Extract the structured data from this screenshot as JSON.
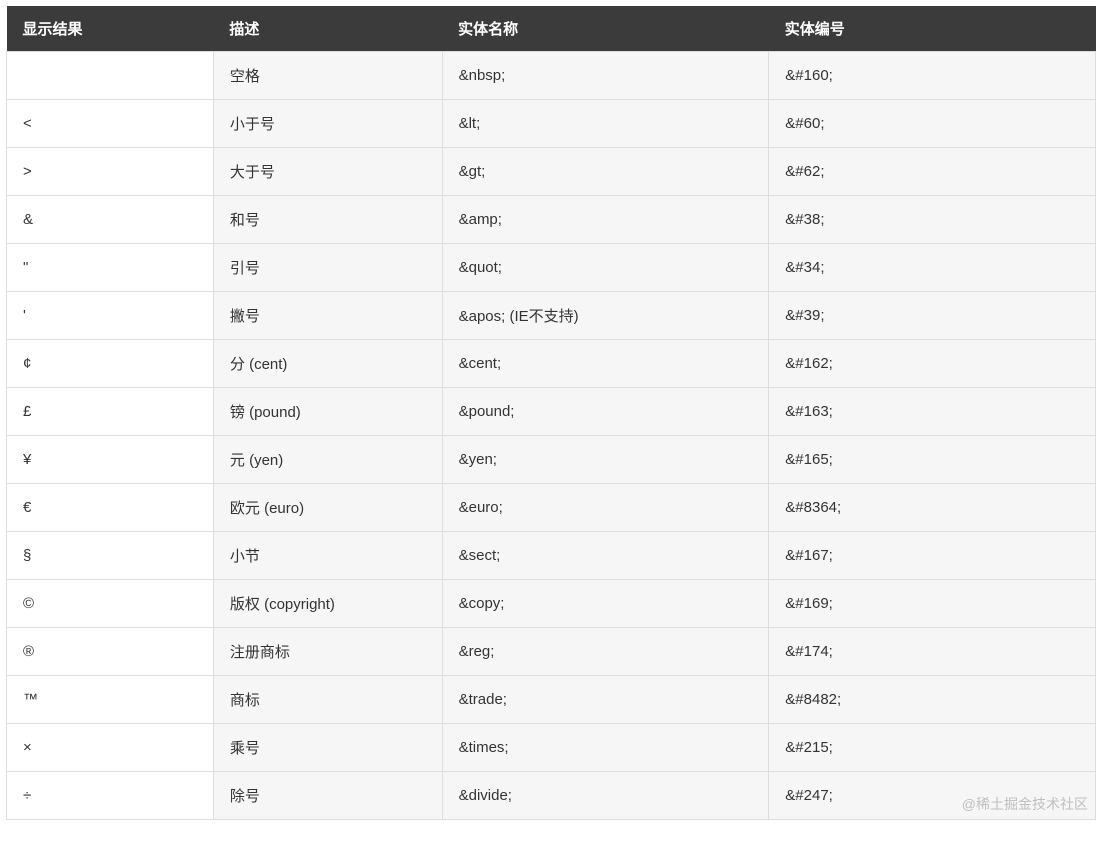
{
  "table": {
    "headers": {
      "result": "显示结果",
      "desc": "描述",
      "name": "实体名称",
      "num": "实体编号"
    },
    "rows": [
      {
        "result": " ",
        "desc": "空格",
        "name": "&nbsp;",
        "num": "&#160;"
      },
      {
        "result": "<",
        "desc": "小于号",
        "name": "&lt;",
        "num": "&#60;"
      },
      {
        "result": ">",
        "desc": "大于号",
        "name": "&gt;",
        "num": "&#62;"
      },
      {
        "result": "&",
        "desc": "和号",
        "name": "&amp;",
        "num": "&#38;"
      },
      {
        "result": "\"",
        "desc": "引号",
        "name": "&quot;",
        "num": "&#34;"
      },
      {
        "result": "'",
        "desc": "撇号",
        "name": "&apos; (IE不支持)",
        "num": "&#39;"
      },
      {
        "result": "¢",
        "desc": "分 (cent)",
        "name": "&cent;",
        "num": "&#162;"
      },
      {
        "result": "£",
        "desc": "镑 (pound)",
        "name": "&pound;",
        "num": "&#163;"
      },
      {
        "result": "¥",
        "desc": "元 (yen)",
        "name": "&yen;",
        "num": "&#165;"
      },
      {
        "result": "€",
        "desc": "欧元 (euro)",
        "name": "&euro;",
        "num": "&#8364;"
      },
      {
        "result": "§",
        "desc": "小节",
        "name": "&sect;",
        "num": "&#167;"
      },
      {
        "result": "©",
        "desc": "版权 (copyright)",
        "name": "&copy;",
        "num": "&#169;"
      },
      {
        "result": "®",
        "desc": "注册商标",
        "name": "&reg;",
        "num": "&#174;"
      },
      {
        "result": "™",
        "desc": "商标",
        "name": "&trade;",
        "num": "&#8482;"
      },
      {
        "result": "×",
        "desc": "乘号",
        "name": "&times;",
        "num": "&#215;"
      },
      {
        "result": "÷",
        "desc": "除号",
        "name": "&divide;",
        "num": "&#247;"
      }
    ]
  },
  "watermark": "@稀土掘金技术社区"
}
